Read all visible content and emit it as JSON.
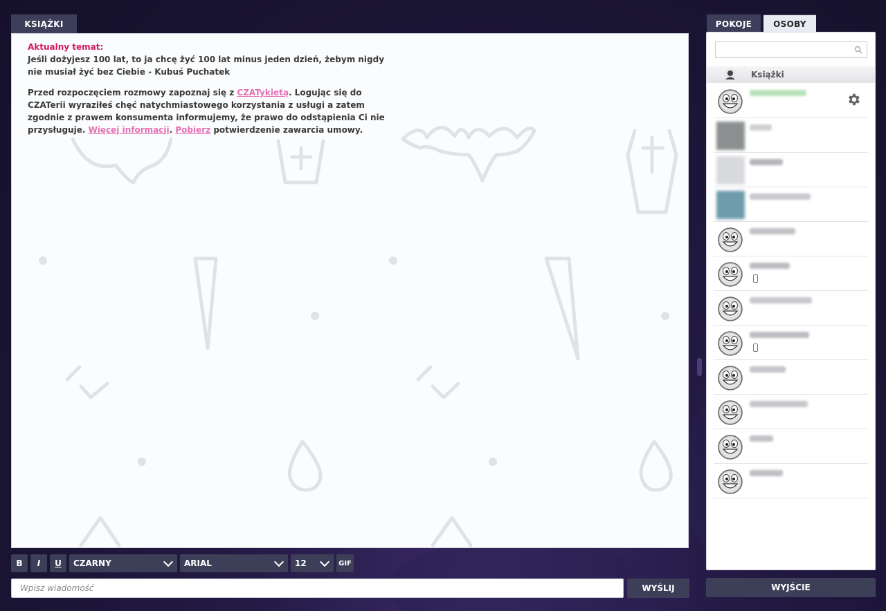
{
  "room_tab": {
    "label": "KSIĄŻKI"
  },
  "chat": {
    "topic_label": "Aktualny temat:",
    "topic_text": "Jeśli dożyjesz 100 lat, to ja chcę żyć 100 lat minus jeden dzień, żebym nigdy nie musiał żyć bez Ciebie - Kubuś Puchatek",
    "notice_part1": "Przed rozpoczęciem rozmowy zapoznaj się z ",
    "notice_link1": "CZATykietą",
    "notice_part2": ". Logując się do CZATerii wyraziłeś chęć natychmiastowego korzystania z usługi a zatem zgodnie z prawem konsumenta informujemy, że prawo do odstąpienia Ci nie przysługuje. ",
    "notice_link2": "Więcej informacji",
    "notice_part3": ". ",
    "notice_link3": "Pobierz",
    "notice_part4": " potwierdzenie zawarcia umowy."
  },
  "toolbar": {
    "bold": "B",
    "italic": "I",
    "underline": "U",
    "color_select": "CZARNY",
    "font_select": "ARIAL",
    "size_select": "12",
    "gif": "GIF"
  },
  "input": {
    "placeholder": "Wpisz wiadomość"
  },
  "send_button": "WYŚLIJ",
  "right_tabs": {
    "rooms": "POKOJE",
    "people": "OSOBY"
  },
  "users": {
    "room_name": "Książki",
    "list": [
      {
        "avatar": "smiley-icon",
        "nick_color": "#b9e2b9",
        "has_settings": true,
        "mobile": false
      },
      {
        "avatar": "photo",
        "photo_color": "#8c8f90",
        "nick_color": "#d0d0d4",
        "has_settings": false,
        "mobile": false
      },
      {
        "avatar": "photo",
        "photo_color": "#d9dadd",
        "nick_color": "#b5b5ba",
        "has_settings": false,
        "mobile": false
      },
      {
        "avatar": "photo",
        "photo_color": "#6f9cad",
        "nick_color": "#c9c9ce",
        "has_settings": false,
        "mobile": false
      },
      {
        "avatar": "smiley-icon",
        "nick_color": "#c2c2c7",
        "has_settings": false,
        "mobile": false
      },
      {
        "avatar": "smiley-icon",
        "nick_color": "#bdbdc2",
        "has_settings": false,
        "mobile": true
      },
      {
        "avatar": "smiley-icon",
        "nick_color": "#c7c7cc",
        "has_settings": false,
        "mobile": false
      },
      {
        "avatar": "smiley-icon",
        "nick_color": "#bcbcc2",
        "has_settings": false,
        "mobile": true
      },
      {
        "avatar": "smiley-icon",
        "nick_color": "#c4c4c9",
        "has_settings": false,
        "mobile": false
      },
      {
        "avatar": "smiley-icon",
        "nick_color": "#c6c6cb",
        "has_settings": false,
        "mobile": false
      },
      {
        "avatar": "smiley-icon",
        "nick_color": "#c1c1c6",
        "has_settings": false,
        "mobile": false
      },
      {
        "avatar": "smiley-icon",
        "nick_color": "#bfbfc4",
        "has_settings": false,
        "mobile": false
      }
    ]
  },
  "exit_button": "WYJŚCIE"
}
